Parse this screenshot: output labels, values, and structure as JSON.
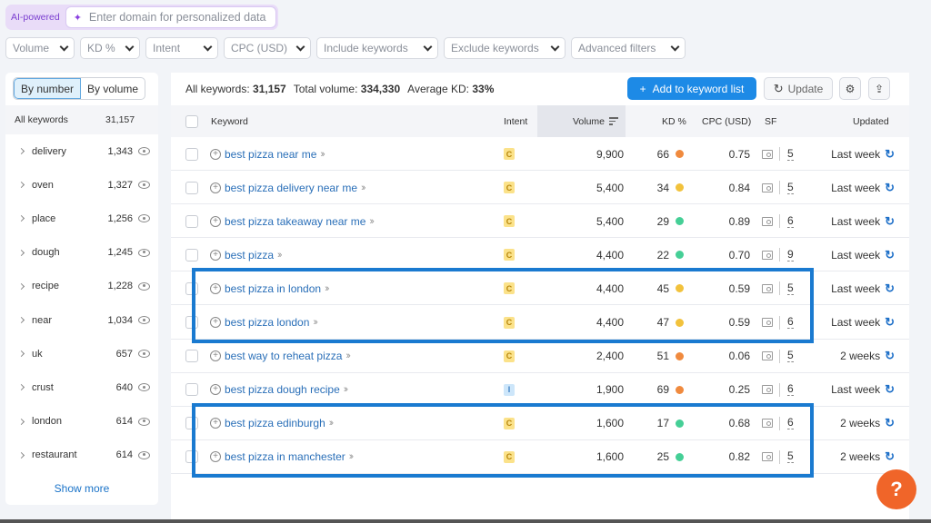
{
  "ai_bar": {
    "label": "AI-powered",
    "placeholder": "Enter domain for personalized data"
  },
  "filters": [
    "Volume",
    "KD %",
    "Intent",
    "CPC (USD)",
    "Include keywords",
    "Exclude keywords",
    "Advanced filters"
  ],
  "sidebar": {
    "toggle": {
      "by_number": "By number",
      "by_volume": "By volume",
      "active": "By number"
    },
    "all_keywords": {
      "label": "All keywords",
      "count": "31,157"
    },
    "groups": [
      {
        "label": "delivery",
        "count": "1,343"
      },
      {
        "label": "oven",
        "count": "1,327"
      },
      {
        "label": "place",
        "count": "1,256"
      },
      {
        "label": "dough",
        "count": "1,245"
      },
      {
        "label": "recipe",
        "count": "1,228"
      },
      {
        "label": "near",
        "count": "1,034"
      },
      {
        "label": "uk",
        "count": "657"
      },
      {
        "label": "crust",
        "count": "640"
      },
      {
        "label": "london",
        "count": "614"
      },
      {
        "label": "restaurant",
        "count": "614"
      }
    ],
    "show_more": "Show more"
  },
  "summary": {
    "all_keywords_label": "All keywords:",
    "all_keywords_value": "31,157",
    "total_volume_label": "Total volume:",
    "total_volume_value": "334,330",
    "avg_kd_label": "Average KD:",
    "avg_kd_value": "33%"
  },
  "toolbar": {
    "add_label": "Add to keyword list",
    "update_label": "Update"
  },
  "columns": {
    "keyword": "Keyword",
    "intent": "Intent",
    "volume": "Volume",
    "kd": "KD %",
    "cpc": "CPC (USD)",
    "sf": "SF",
    "updated": "Updated"
  },
  "colors": {
    "kd_hard": "#f08a3e",
    "kd_medium": "#f2c23c",
    "kd_easy": "#45cf96",
    "intent_commercial_bg": "#fbe28a",
    "intent_commercial_fg": "#b8860b",
    "intent_info_bg": "#cde6fa",
    "intent_info_fg": "#3b7fc4",
    "highlight": "#1a7ad0",
    "accent": "#1d8ae6",
    "help": "#f06529"
  },
  "rows": [
    {
      "keyword": "best pizza near me",
      "intent": "C",
      "volume": "9,900",
      "kd": "66",
      "kd_level": "hard",
      "cpc": "0.75",
      "sf": "5",
      "updated": "Last week"
    },
    {
      "keyword": "best pizza delivery near me",
      "intent": "C",
      "volume": "5,400",
      "kd": "34",
      "kd_level": "medium",
      "cpc": "0.84",
      "sf": "5",
      "updated": "Last week"
    },
    {
      "keyword": "best pizza takeaway near me",
      "intent": "C",
      "volume": "5,400",
      "kd": "29",
      "kd_level": "easy",
      "cpc": "0.89",
      "sf": "6",
      "updated": "Last week"
    },
    {
      "keyword": "best pizza",
      "intent": "C",
      "volume": "4,400",
      "kd": "22",
      "kd_level": "easy",
      "cpc": "0.70",
      "sf": "9",
      "updated": "Last week"
    },
    {
      "keyword": "best pizza in london",
      "intent": "C",
      "volume": "4,400",
      "kd": "45",
      "kd_level": "medium",
      "cpc": "0.59",
      "sf": "5",
      "updated": "Last week"
    },
    {
      "keyword": "best pizza london",
      "intent": "C",
      "volume": "4,400",
      "kd": "47",
      "kd_level": "medium",
      "cpc": "0.59",
      "sf": "6",
      "updated": "Last week"
    },
    {
      "keyword": "best way to reheat pizza",
      "intent": "C",
      "volume": "2,400",
      "kd": "51",
      "kd_level": "hard",
      "cpc": "0.06",
      "sf": "5",
      "updated": "2 weeks"
    },
    {
      "keyword": "best pizza dough recipe",
      "intent": "I",
      "volume": "1,900",
      "kd": "69",
      "kd_level": "hard",
      "cpc": "0.25",
      "sf": "6",
      "updated": "Last week"
    },
    {
      "keyword": "best pizza edinburgh",
      "intent": "C",
      "volume": "1,600",
      "kd": "17",
      "kd_level": "easy",
      "cpc": "0.68",
      "sf": "6",
      "updated": "2 weeks"
    },
    {
      "keyword": "best pizza in manchester",
      "intent": "C",
      "volume": "1,600",
      "kd": "25",
      "kd_level": "easy",
      "cpc": "0.82",
      "sf": "5",
      "updated": "2 weeks"
    }
  ],
  "highlights": [
    [
      4,
      5
    ],
    [
      8,
      9
    ]
  ],
  "help_label": "?"
}
